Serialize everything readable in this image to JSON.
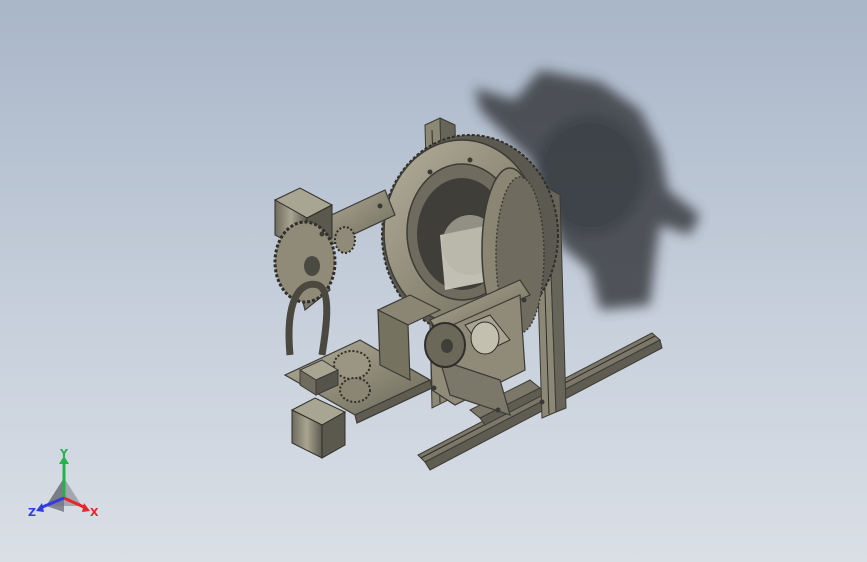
{
  "viewport": {
    "background_top": "#a9b6c8",
    "background_bottom": "#dadfe6",
    "model_color": "#8f8b78",
    "model_dark": "#55534a",
    "shadow_color": "#3a3d42"
  },
  "triad": {
    "x_label": "X",
    "y_label": "Y",
    "z_label": "Z",
    "x_color": "#e8262a",
    "y_color": "#24b34a",
    "z_color": "#2f3ce0"
  }
}
